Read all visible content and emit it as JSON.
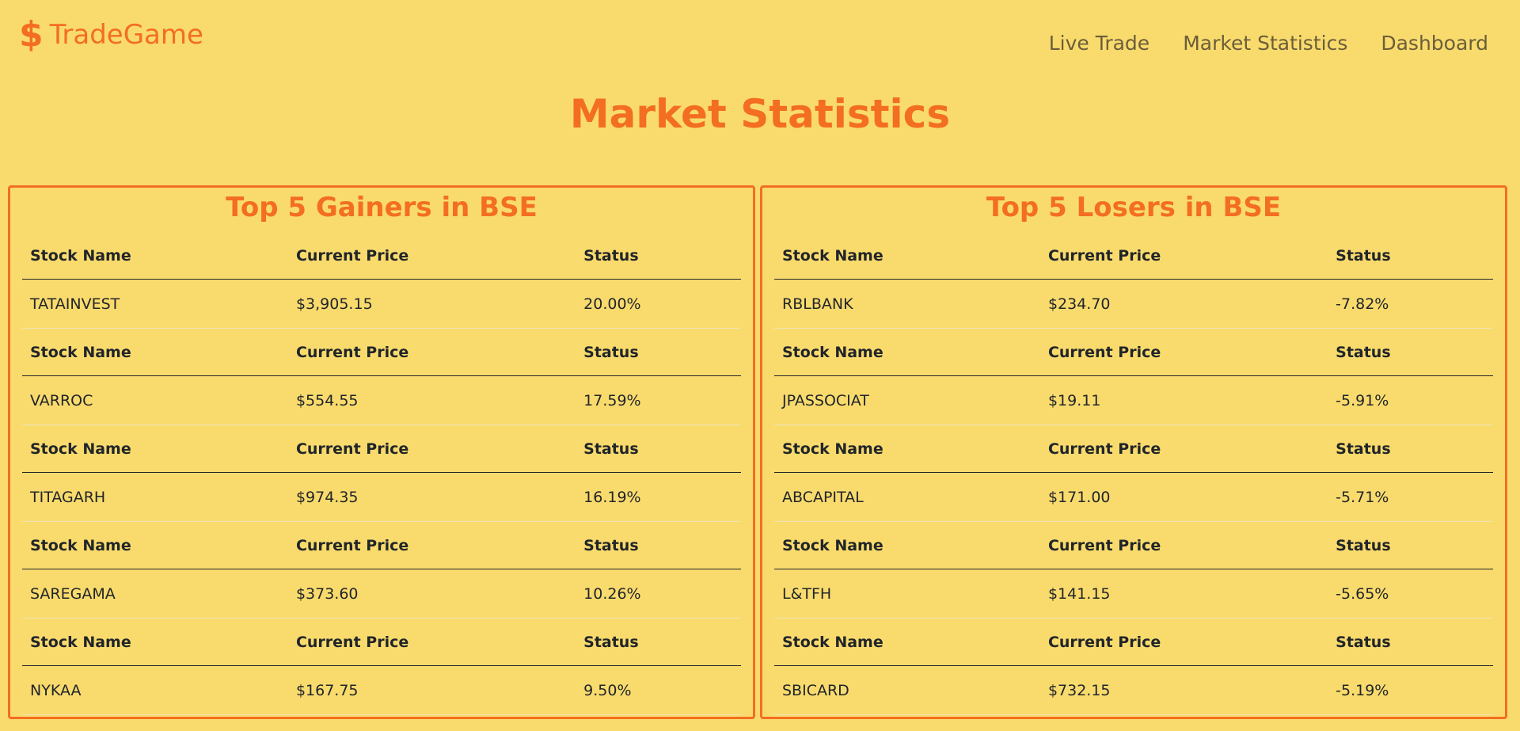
{
  "brand": {
    "icon": "$",
    "name": "TradeGame"
  },
  "nav": {
    "items": [
      "Live Trade",
      "Market Statistics",
      "Dashboard"
    ]
  },
  "page": {
    "title": "Market Statistics"
  },
  "headers": {
    "name": "Stock Name",
    "price": "Current Price",
    "status": "Status"
  },
  "gainers": {
    "title": "Top 5 Gainers in BSE",
    "rows": [
      {
        "name": "TATAINVEST",
        "price": "$3,905.15",
        "status": "20.00%"
      },
      {
        "name": "VARROC",
        "price": "$554.55",
        "status": "17.59%"
      },
      {
        "name": "TITAGARH",
        "price": "$974.35",
        "status": "16.19%"
      },
      {
        "name": "SAREGAMA",
        "price": "$373.60",
        "status": "10.26%"
      },
      {
        "name": "NYKAA",
        "price": "$167.75",
        "status": "9.50%"
      }
    ]
  },
  "losers": {
    "title": "Top 5 Losers in BSE",
    "rows": [
      {
        "name": "RBLBANK",
        "price": "$234.70",
        "status": "-7.82%"
      },
      {
        "name": "JPASSOCIAT",
        "price": "$19.11",
        "status": "-5.91%"
      },
      {
        "name": "ABCAPITAL",
        "price": "$171.00",
        "status": "-5.71%"
      },
      {
        "name": "L&TFH",
        "price": "$141.15",
        "status": "-5.65%"
      },
      {
        "name": "SBICARD",
        "price": "$732.15",
        "status": "-5.19%"
      }
    ]
  },
  "colors": {
    "background": "#f9db6d",
    "accent": "#f36e21",
    "text": "#212529",
    "nav_text": "#6b5e3a"
  }
}
